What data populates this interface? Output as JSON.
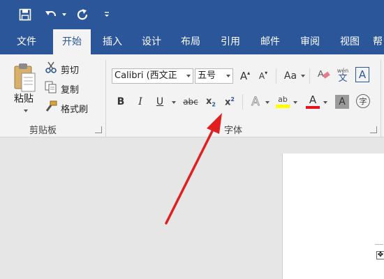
{
  "quick_access": {
    "save_icon": "save-icon",
    "undo_icon": "undo-icon",
    "repeat_icon": "repeat-icon",
    "customize_icon": "customize-qat-icon"
  },
  "menu": {
    "tabs": [
      {
        "label": "文件"
      },
      {
        "label": "开始",
        "active": true
      },
      {
        "label": "插入"
      },
      {
        "label": "设计"
      },
      {
        "label": "布局"
      },
      {
        "label": "引用"
      },
      {
        "label": "邮件"
      },
      {
        "label": "审阅"
      },
      {
        "label": "视图"
      },
      {
        "label": "帮"
      }
    ]
  },
  "clipboard": {
    "paste_label": "粘贴",
    "cut_label": "剪切",
    "copy_label": "复制",
    "format_painter_label": "格式刷",
    "group_label": "剪贴板"
  },
  "font": {
    "font_name": "Calibri (西文正",
    "font_size": "五号",
    "grow_glyph": "A",
    "shrink_glyph": "A",
    "case_glyph": "Aa",
    "pinyin_top": "wén",
    "pinyin_char": "文",
    "border_glyph": "A",
    "bold": "B",
    "italic": "I",
    "underline": "U",
    "strike": "abc",
    "subscript": "x",
    "subscript_sub": "2",
    "superscript": "x",
    "superscript_sup": "2",
    "effects_glyph": "A",
    "highlight_glyph": "ab",
    "font_color_glyph": "A",
    "shading_glyph": "A",
    "enclose_glyph": "字",
    "group_label": "字体",
    "colors": {
      "highlight": "#ffff00",
      "font_color": "#e81123",
      "annotation_arrow": "#e02020",
      "ribbon_blue": "#2b579a"
    }
  },
  "document": {
    "move_handle_icon": "table-move-handle-icon"
  }
}
